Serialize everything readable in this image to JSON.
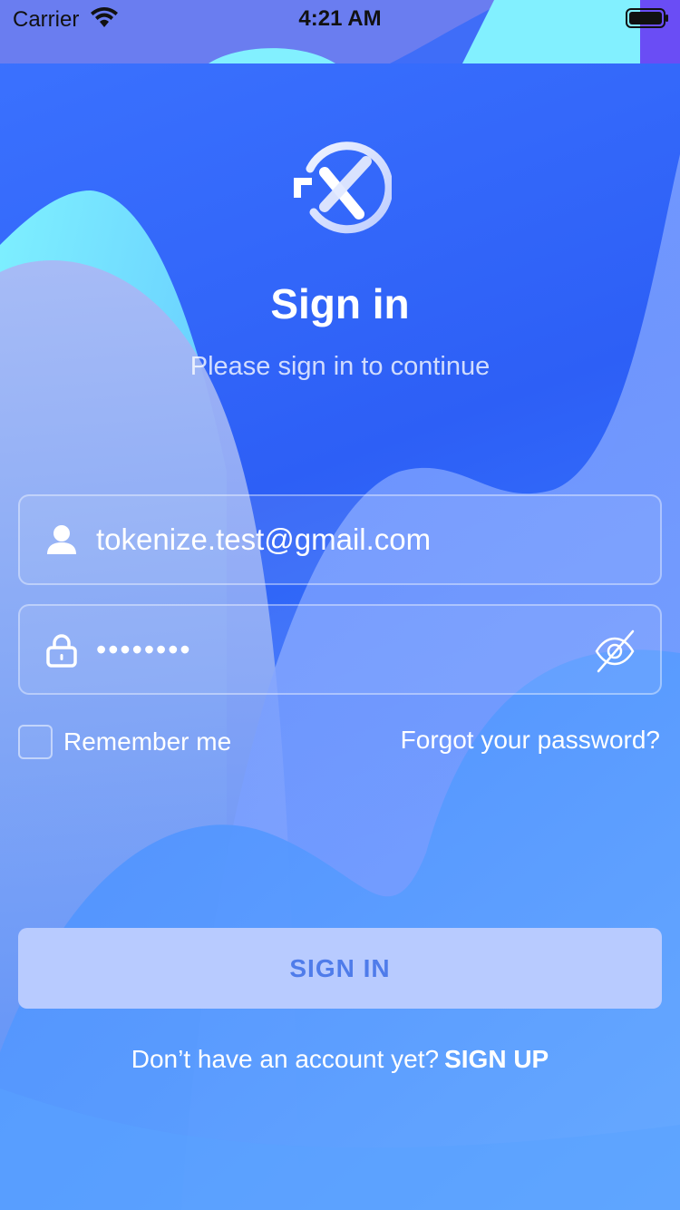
{
  "status_bar": {
    "carrier": "Carrier",
    "time": "4:21 AM"
  },
  "header": {
    "title": "Sign in",
    "subtitle": "Please sign in to continue"
  },
  "form": {
    "email": {
      "value": "tokenize.test@gmail.com",
      "icon": "user-icon"
    },
    "password": {
      "masked_value": "••••••••",
      "icon": "lock-icon",
      "toggle_icon": "eye-off-icon"
    },
    "remember_me": {
      "label": "Remember me",
      "checked": false
    },
    "forgot_password": "Forgot your password?",
    "submit_label": "SIGN IN"
  },
  "footer": {
    "prompt": "Don’t have an account yet?",
    "signup_label": "SIGN UP"
  },
  "colors": {
    "background": "#2d62f5",
    "button_bg": "#b8cbff",
    "button_text": "#4f7cea"
  }
}
